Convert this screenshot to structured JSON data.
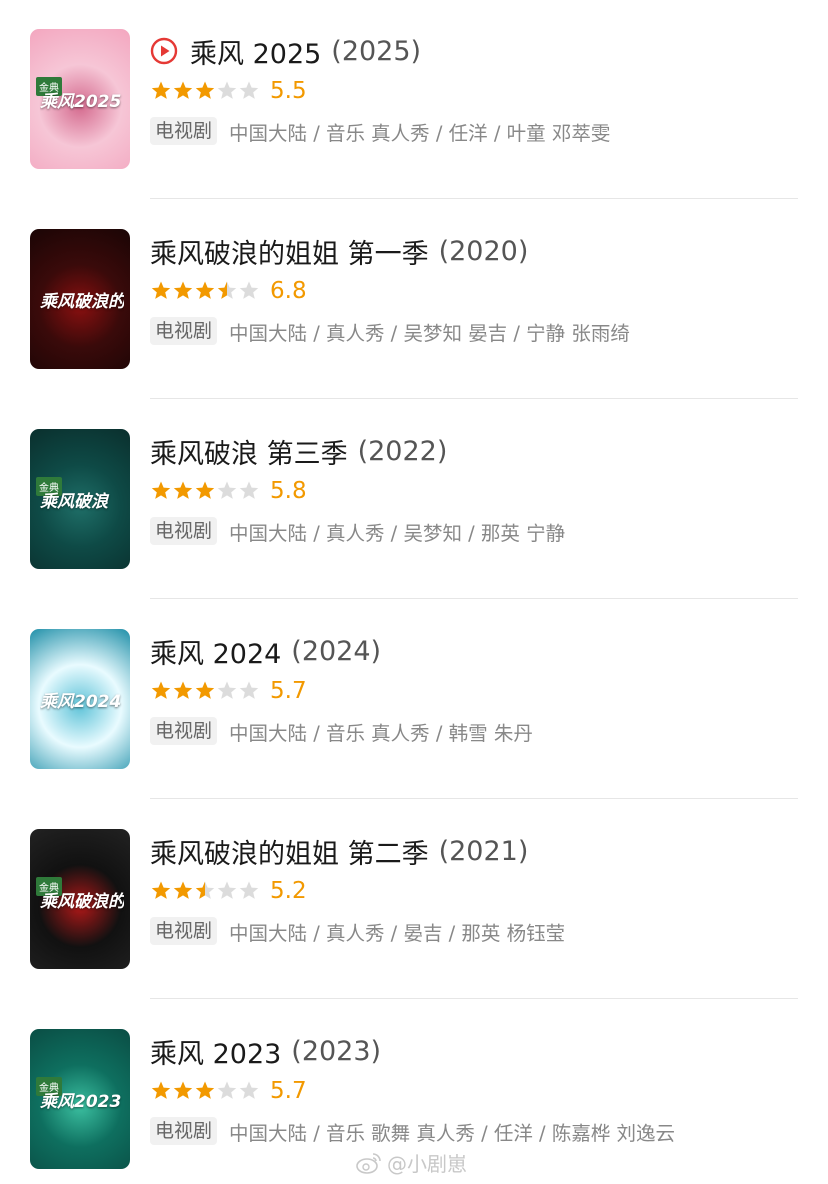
{
  "colors": {
    "star_filled": "#f29900",
    "star_empty": "#dcdcdc",
    "score": "#f29900",
    "play_icon": "#e53935"
  },
  "results": [
    {
      "title": "乘风 2025",
      "year": "(2025)",
      "has_play_icon": true,
      "score": "5.5",
      "stars_filled": 3,
      "stars_half": false,
      "badge": "电视剧",
      "meta": "中国大陆 / 音乐 真人秀 / 任洋 / 叶童 邓萃雯",
      "poster_logo": "乘风2025",
      "poster_tag": "金典",
      "poster_colors": [
        "#f6c6d6",
        "#d46a8e",
        "#f3a6bf"
      ]
    },
    {
      "title": "乘风破浪的姐姐 第一季",
      "year": "(2020)",
      "has_play_icon": false,
      "score": "6.8",
      "stars_filled": 3,
      "stars_half": true,
      "badge": "电视剧",
      "meta": "中国大陆 / 真人秀 / 吴梦知 晏吉 / 宁静 张雨绮",
      "poster_logo": "乘风破浪的姐姐",
      "poster_tag": "",
      "poster_colors": [
        "#3a0a0a",
        "#8a1010",
        "#1a0505"
      ]
    },
    {
      "title": "乘风破浪 第三季",
      "year": "(2022)",
      "has_play_icon": false,
      "score": "5.8",
      "stars_filled": 3,
      "stars_half": false,
      "badge": "电视剧",
      "meta": "中国大陆 / 真人秀 / 吴梦知 / 那英 宁静",
      "poster_logo": "乘风破浪",
      "poster_tag": "金典",
      "poster_colors": [
        "#0e4a46",
        "#1f6f68",
        "#0a2f2d"
      ]
    },
    {
      "title": "乘风 2024",
      "year": "(2024)",
      "has_play_icon": false,
      "score": "5.7",
      "stars_filled": 3,
      "stars_half": false,
      "badge": "电视剧",
      "meta": "中国大陆 / 音乐 真人秀 / 韩雪 朱丹",
      "poster_logo": "乘风2024",
      "poster_tag": "",
      "poster_colors": [
        "#e9fbff",
        "#5fc3d8",
        "#1f8fa8"
      ]
    },
    {
      "title": "乘风破浪的姐姐 第二季",
      "year": "(2021)",
      "has_play_icon": false,
      "score": "5.2",
      "stars_filled": 2,
      "stars_half": true,
      "badge": "电视剧",
      "meta": "中国大陆 / 真人秀 / 晏吉 / 那英 杨钰莹",
      "poster_logo": "乘风破浪的姐姐",
      "poster_tag": "金典",
      "poster_colors": [
        "#111111",
        "#b01818",
        "#222222"
      ]
    },
    {
      "title": "乘风 2023",
      "year": "(2023)",
      "has_play_icon": false,
      "score": "5.7",
      "stars_filled": 3,
      "stars_half": false,
      "badge": "电视剧",
      "meta": "中国大陆 / 音乐 歌舞 真人秀 / 任洋 / 陈嘉桦 刘逸云",
      "poster_logo": "乘风2023",
      "poster_tag": "金典",
      "poster_colors": [
        "#0e6f5f",
        "#3bbfa0",
        "#0a4d44"
      ]
    }
  ],
  "watermark": {
    "text": "@小剧崽"
  }
}
